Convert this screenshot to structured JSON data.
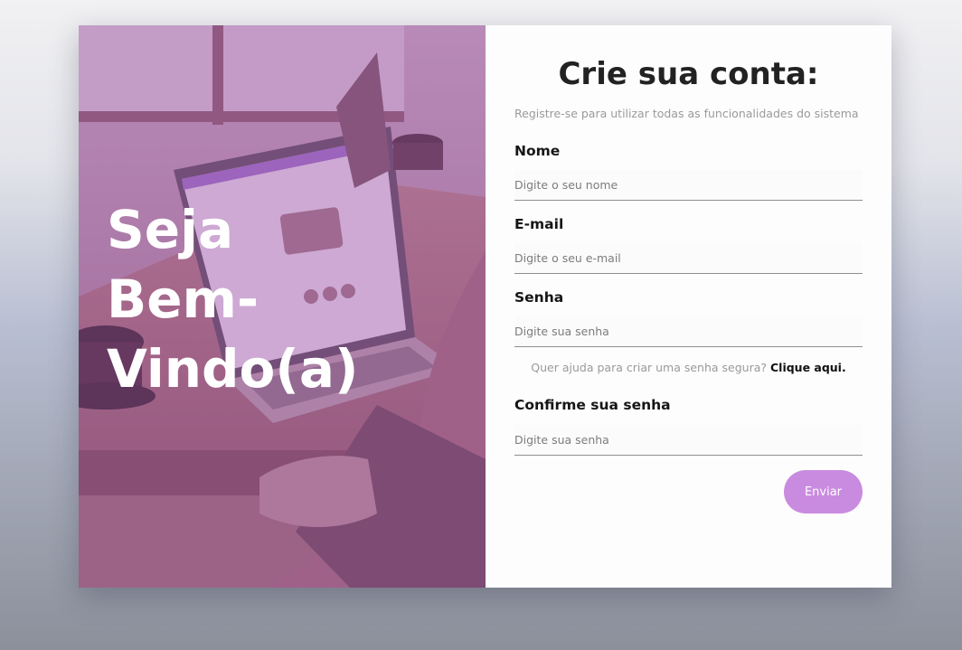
{
  "hero": {
    "title": "Seja\nBem-\nVindo(a)"
  },
  "form": {
    "title": "Crie sua conta:",
    "subtitle": "Registre-se para utilizar todas as funcionalidades do sistema",
    "fields": [
      {
        "label": "Nome",
        "placeholder": "Digite o seu nome",
        "value": ""
      },
      {
        "label": "E-mail",
        "placeholder": "Digite o seu e-mail",
        "value": ""
      },
      {
        "label": "Senha",
        "placeholder": "Digite sua senha",
        "value": ""
      },
      {
        "label": "Confirme sua senha",
        "placeholder": "Digite sua senha",
        "value": ""
      }
    ],
    "help": {
      "text": "Quer ajuda para criar uma senha segura?",
      "link": "Clique aqui."
    },
    "submit_label": "Enviar"
  },
  "colors": {
    "accent": "#c98be0",
    "hero_tint": "#9e56aa",
    "title_text": "#222222"
  }
}
